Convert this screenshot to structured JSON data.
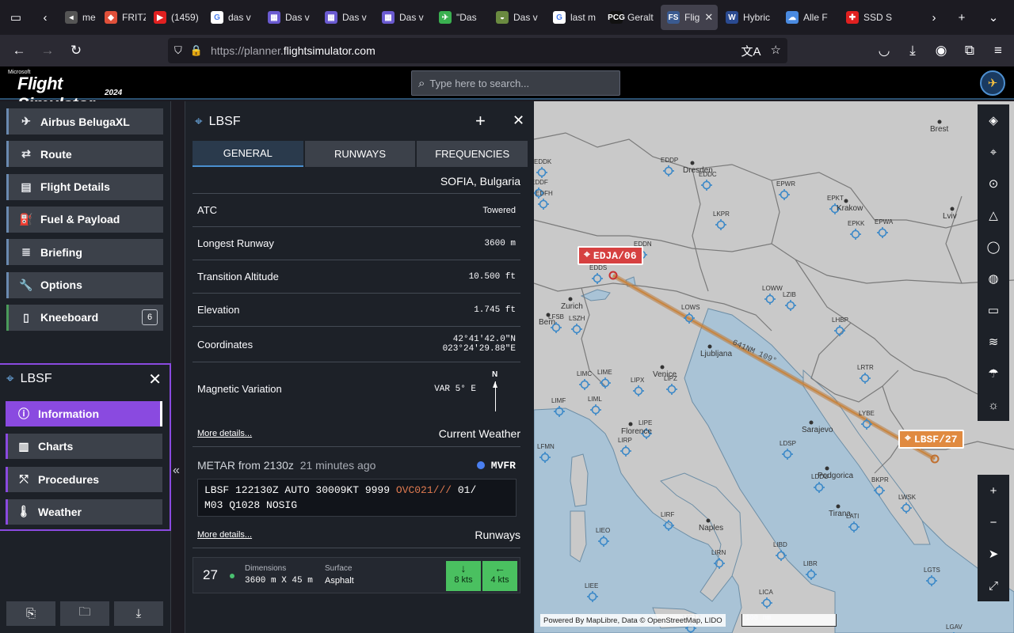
{
  "browser": {
    "tabs": [
      {
        "label": "me",
        "fav": "◂",
        "color": "#555"
      },
      {
        "label": "FRITZ",
        "fav": "◆",
        "color": "#e0503a"
      },
      {
        "label": "(1459)",
        "fav": "▶",
        "color": "#e02020"
      },
      {
        "label": "das v",
        "fav": "G",
        "color": "#ffffff"
      },
      {
        "label": "Das v",
        "fav": "▦",
        "color": "#6a5ad0"
      },
      {
        "label": "Das v",
        "fav": "▦",
        "color": "#6a5ad0"
      },
      {
        "label": "Das v",
        "fav": "▦",
        "color": "#6a5ad0"
      },
      {
        "label": "\"Das",
        "fav": "✈",
        "color": "#3ab050"
      },
      {
        "label": "Das v",
        "fav": "◒",
        "color": "#6a8a40"
      },
      {
        "label": "last m",
        "fav": "G",
        "color": "#ffffff"
      },
      {
        "label": "Geralt",
        "fav": "PCG",
        "color": "#111111"
      },
      {
        "label": "Flig",
        "fav": "FS",
        "color": "#3a5a90",
        "active": true
      },
      {
        "label": "Hybric",
        "fav": "W",
        "color": "#2a4a90"
      },
      {
        "label": "Alle F",
        "fav": "☁",
        "color": "#4a8ae0"
      },
      {
        "label": "SSD S",
        "fav": "✚",
        "color": "#e02020"
      }
    ],
    "url_prefix": "https://planner.",
    "url_domain": "flightsimulator.com"
  },
  "app": {
    "logo_ms": "Microsoft",
    "logo_title": "Flight Simulator",
    "logo_year": "2024",
    "search_placeholder": "Type here to search..."
  },
  "sidebar": {
    "items": [
      {
        "label": "Airbus BelugaXL",
        "icon": "✈"
      },
      {
        "label": "Route",
        "icon": "⇄"
      },
      {
        "label": "Flight Details",
        "icon": "▤"
      },
      {
        "label": "Fuel & Payload",
        "icon": "⛽"
      },
      {
        "label": "Briefing",
        "icon": "≣"
      },
      {
        "label": "Options",
        "icon": "🔧"
      },
      {
        "label": "Kneeboard",
        "icon": "▯",
        "badge": "6"
      }
    ],
    "airport_code": "LBSF",
    "sub_items": [
      {
        "label": "Information",
        "icon": "ⓘ",
        "active": true
      },
      {
        "label": "Charts",
        "icon": "▥"
      },
      {
        "label": "Procedures",
        "icon": "⤲"
      },
      {
        "label": "Weather",
        "icon": "🌡"
      }
    ]
  },
  "panel": {
    "title": "LBSF",
    "tabs": [
      "GENERAL",
      "RUNWAYS",
      "FREQUENCIES"
    ],
    "location": "SOFIA, Bulgaria",
    "rows": [
      {
        "label": "ATC",
        "value": "Towered"
      },
      {
        "label": "Longest Runway",
        "value": "3600 m"
      },
      {
        "label": "Transition Altitude",
        "value": "10.500 ft"
      },
      {
        "label": "Elevation",
        "value": "1.745 ft"
      },
      {
        "label": "Coordinates",
        "value": "42°41'42.0\"N",
        "value2": "023°24'29.88\"E"
      },
      {
        "label": "Magnetic Variation",
        "value": "VAR 5° E",
        "compass": "N"
      }
    ],
    "more_details": "More details...",
    "weather_title": "Current Weather",
    "metar_prefix": "METAR from",
    "metar_time": "2130z",
    "metar_ago": "21 minutes ago",
    "flight_category": "MVFR",
    "metar_a": "LBSF 122130Z AUTO 30009KT 9999 ",
    "metar_ovc": "OVC021///",
    "metar_b": " 01/",
    "metar_c": "M03 Q1028 NOSIG",
    "runways_title": "Runways",
    "runway": {
      "number": "27",
      "dim_label": "Dimensions",
      "dim_value": "3600 m X 45 m",
      "surf_label": "Surface",
      "surf_value": "Asphalt",
      "wind1": "8 kts",
      "wind2": "4 kts"
    }
  },
  "map": {
    "origin_tag": "EDJA/06",
    "dest_tag": "LBSF/27",
    "leg_label": "641NM 109°",
    "attribution": "Powered By  MapLibre, Data ©  OpenStreetMap,  LIDO",
    "scale": "100 nm",
    "airports": [
      {
        "c": "EDDP"
      },
      {
        "c": "EDDC"
      },
      {
        "c": "EPWR"
      },
      {
        "c": "EPKT"
      },
      {
        "c": "EPWA"
      },
      {
        "c": "EDDF"
      },
      {
        "c": "LKPR"
      },
      {
        "c": "EPKK"
      },
      {
        "c": "EDDN"
      },
      {
        "c": "EDDS"
      },
      {
        "c": "LOWW"
      },
      {
        "c": "LZIB"
      },
      {
        "c": "LOWS"
      },
      {
        "c": "LFSB"
      },
      {
        "c": "LSZH"
      },
      {
        "c": "LHBP"
      },
      {
        "c": "LIMC"
      },
      {
        "c": "LIME"
      },
      {
        "c": "LIPX"
      },
      {
        "c": "LIPZ"
      },
      {
        "c": "LRTR"
      },
      {
        "c": "LIMF"
      },
      {
        "c": "LIML"
      },
      {
        "c": "LIPE"
      },
      {
        "c": "LYBE"
      },
      {
        "c": "LIRP"
      },
      {
        "c": "LDSP"
      },
      {
        "c": "LFMN"
      },
      {
        "c": "LDDU"
      },
      {
        "c": "BKPR"
      },
      {
        "c": "LWSK"
      },
      {
        "c": "LIRF"
      },
      {
        "c": "LATI"
      },
      {
        "c": "LIEO"
      },
      {
        "c": "LIBD"
      },
      {
        "c": "LIRN"
      },
      {
        "c": "LIBR"
      },
      {
        "c": "LGTS"
      },
      {
        "c": "LIEE"
      },
      {
        "c": "LICA"
      },
      {
        "c": "LICJ"
      },
      {
        "c": "LGAV"
      },
      {
        "c": "EDDK"
      },
      {
        "c": "EDFH"
      }
    ],
    "cities": [
      {
        "n": "Brest"
      },
      {
        "n": "Dresden"
      },
      {
        "n": "Krakow"
      },
      {
        "n": "Lviv"
      },
      {
        "n": "Zurich"
      },
      {
        "n": "Bern"
      },
      {
        "n": "Ljubljana"
      },
      {
        "n": "Venice"
      },
      {
        "n": "Florence"
      },
      {
        "n": "Sarajevo"
      },
      {
        "n": "Podgorica"
      },
      {
        "n": "Tirana"
      },
      {
        "n": "Naples"
      }
    ]
  }
}
